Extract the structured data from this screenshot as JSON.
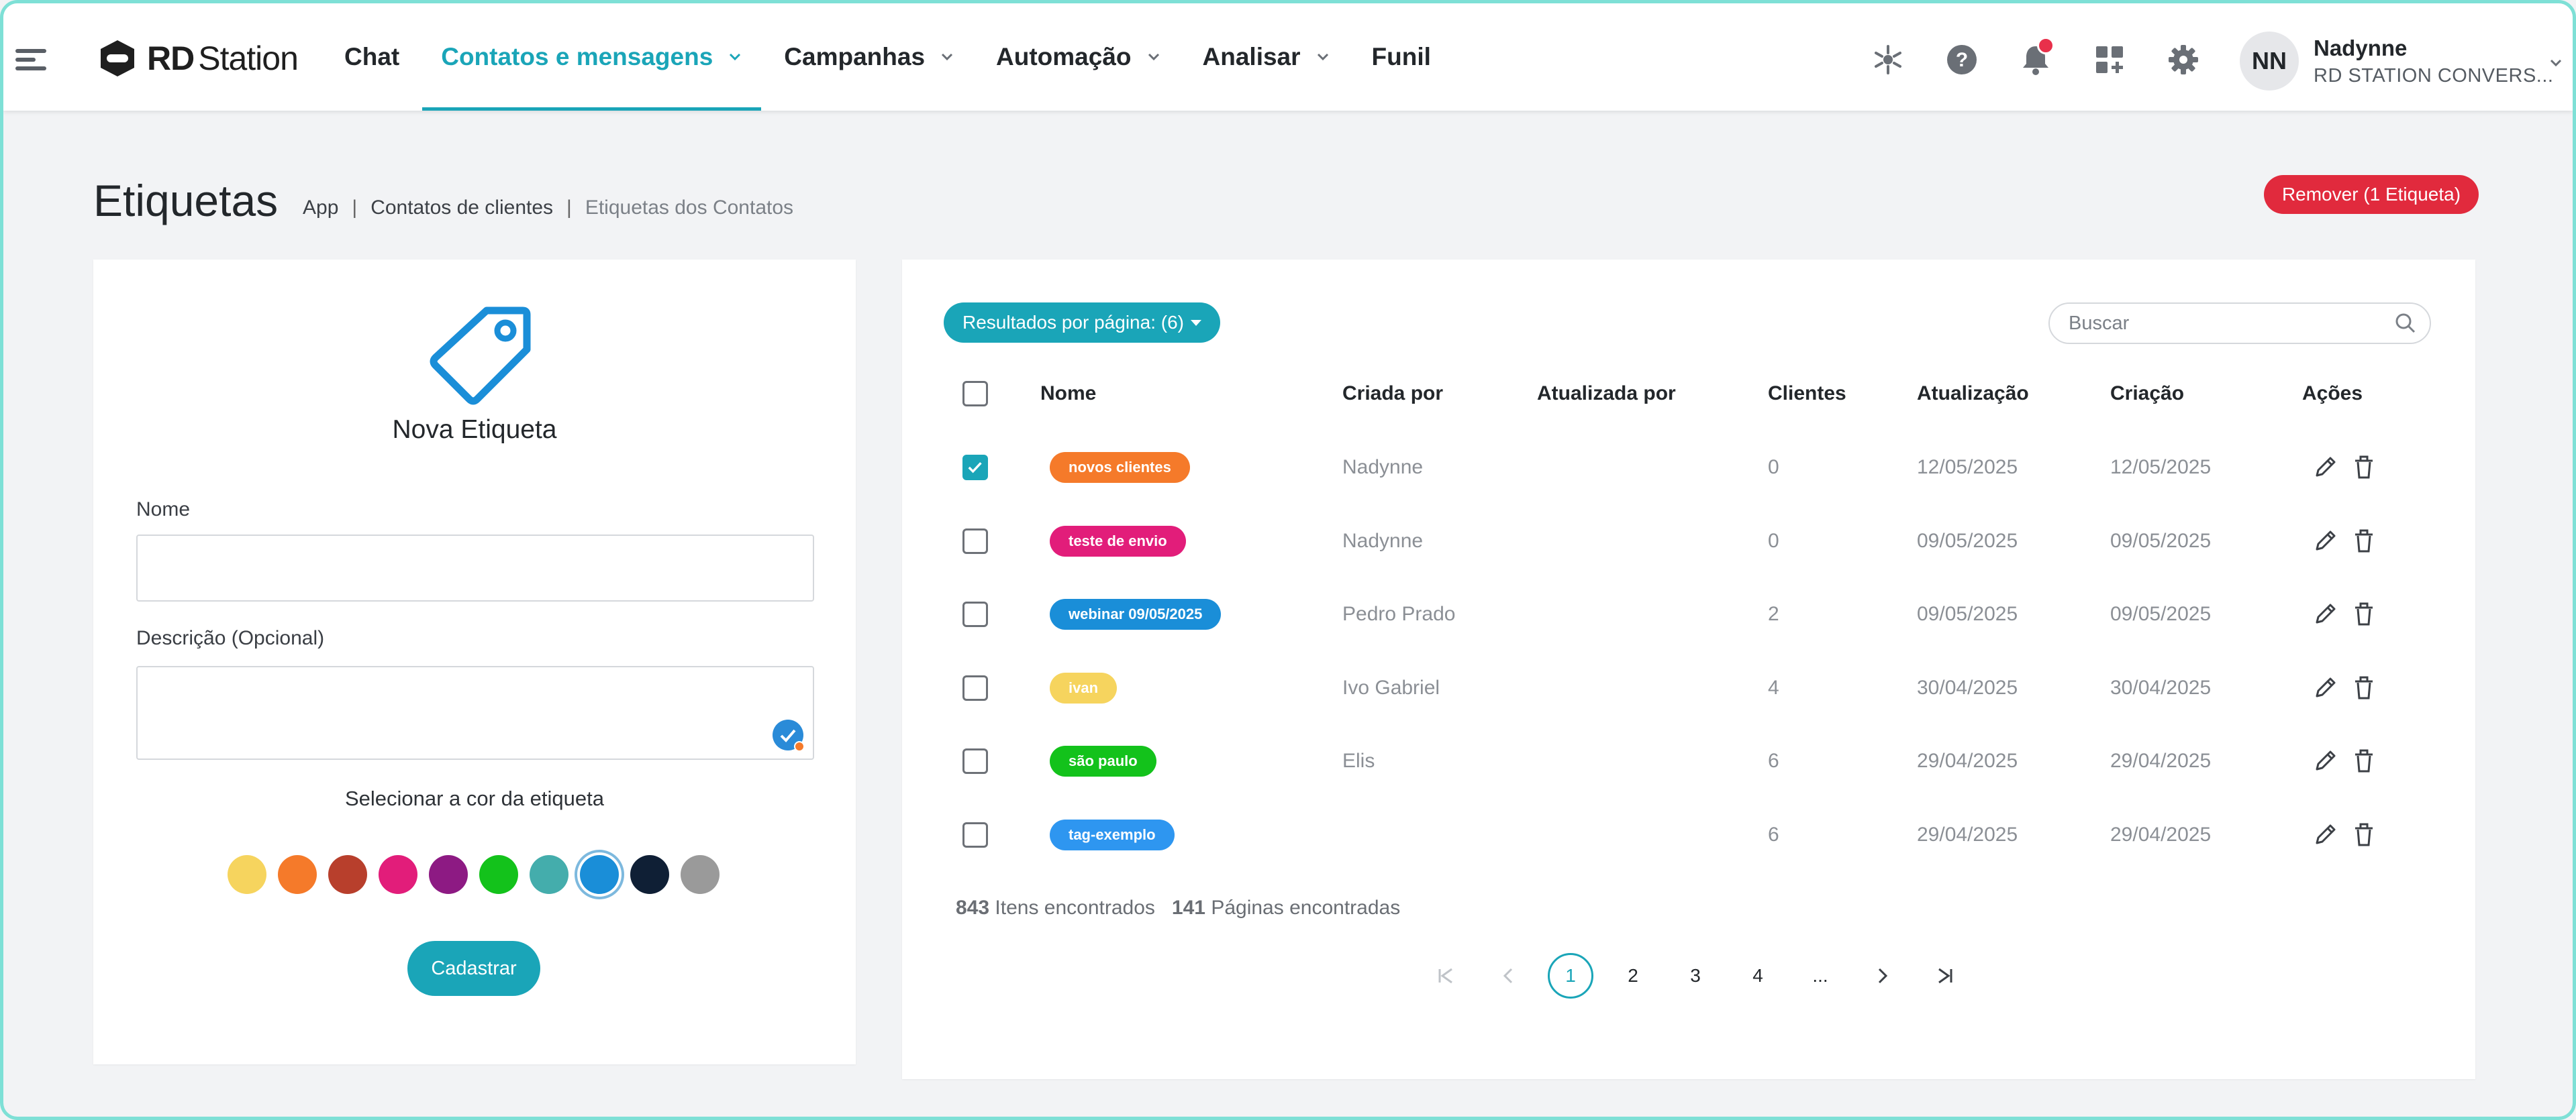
{
  "brand": {
    "logo_bold": "RD",
    "logo_light": "Station"
  },
  "nav": {
    "items": [
      {
        "label": "Chat",
        "dropdown": false,
        "active": false
      },
      {
        "label": "Contatos e mensagens",
        "dropdown": true,
        "active": true
      },
      {
        "label": "Campanhas",
        "dropdown": true,
        "active": false
      },
      {
        "label": "Automação",
        "dropdown": true,
        "active": false
      },
      {
        "label": "Analisar",
        "dropdown": true,
        "active": false
      },
      {
        "label": "Funil",
        "dropdown": false,
        "active": false
      }
    ]
  },
  "top_icons": [
    "integrations-icon",
    "help-icon",
    "bell-icon",
    "apps-icon",
    "settings-icon"
  ],
  "user": {
    "initials": "NN",
    "name": "Nadynne",
    "org": "RD STATION CONVERS..."
  },
  "page": {
    "title": "Etiquetas",
    "breadcrumb": [
      "App",
      "Contatos de clientes",
      "Etiquetas dos Contatos"
    ],
    "remove_button": "Remover (1 Etiqueta)"
  },
  "form": {
    "title": "Nova Etiqueta",
    "name_label": "Nome",
    "name_value": "",
    "description_label": "Descrição (Opcional)",
    "description_value": "",
    "color_label": "Selecionar a cor da etiqueta",
    "colors": [
      "#f6d45e",
      "#f57a2a",
      "#b83f2c",
      "#e21d7a",
      "#8d1a83",
      "#13c21b",
      "#44adac",
      "#1a8ed8",
      "#0f1f35",
      "#9a9a9a"
    ],
    "selected_color_index": 7,
    "submit": "Cadastrar"
  },
  "table": {
    "per_page_label": "Resultados por página: (6)",
    "search_placeholder": "Buscar",
    "columns": [
      "Nome",
      "Criada por",
      "Atualizada por",
      "Clientes",
      "Atualização",
      "Criação",
      "Ações"
    ],
    "rows": [
      {
        "checked": true,
        "name": "novos clientes",
        "color": "#f57a2a",
        "created_by": "Nadynne",
        "updated_by": "",
        "clients": "0",
        "updated": "12/05/2025",
        "created": "12/05/2025"
      },
      {
        "checked": false,
        "name": "teste de envio",
        "color": "#e21d7a",
        "created_by": "Nadynne",
        "updated_by": "",
        "clients": "0",
        "updated": "09/05/2025",
        "created": "09/05/2025"
      },
      {
        "checked": false,
        "name": "webinar 09/05/2025",
        "color": "#1a8ed8",
        "created_by": "Pedro Prado",
        "updated_by": "",
        "clients": "2",
        "updated": "09/05/2025",
        "created": "09/05/2025"
      },
      {
        "checked": false,
        "name": "ivan",
        "color": "#f6d45e",
        "created_by": "Ivo Gabriel",
        "updated_by": "",
        "clients": "4",
        "updated": "30/04/2025",
        "created": "30/04/2025"
      },
      {
        "checked": false,
        "name": "são paulo",
        "color": "#13c21b",
        "created_by": "Elis",
        "updated_by": "",
        "clients": "6",
        "updated": "29/04/2025",
        "created": "29/04/2025"
      },
      {
        "checked": false,
        "name": "tag-exemplo",
        "color": "#2e96f0",
        "created_by": "",
        "updated_by": "",
        "clients": "6",
        "updated": "29/04/2025",
        "created": "29/04/2025"
      }
    ],
    "summary": {
      "items_count": "843",
      "items_label": "Itens encontrados",
      "pages_count": "141",
      "pages_label": "Páginas encontradas"
    },
    "pagination": {
      "pages": [
        "1",
        "2",
        "3",
        "4",
        "..."
      ],
      "current": "1"
    }
  }
}
